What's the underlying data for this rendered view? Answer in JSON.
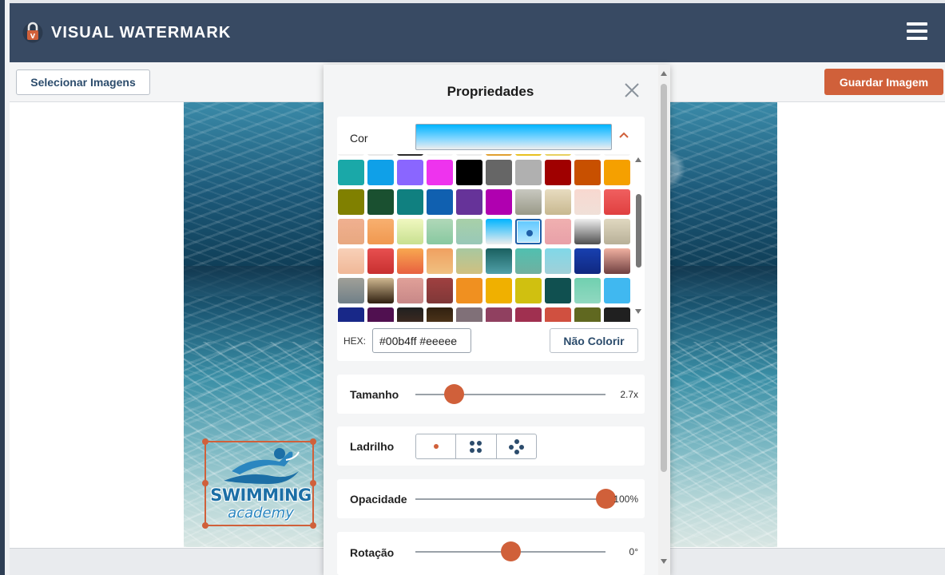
{
  "app": {
    "brand": "VISUAL WATERMARK"
  },
  "toolbar": {
    "select_label": "Selecionar Imagens",
    "save_label": "Guardar Imagem"
  },
  "watermark": {
    "line1": "SWIMMING",
    "line2": "academy"
  },
  "panel": {
    "title": "Propriedades",
    "color": {
      "label": "Cor",
      "hex_label": "HEX:",
      "hex_value": "#00b4ff #eeeee",
      "no_color_label": "Não Colorir"
    },
    "size": {
      "label": "Tamanho",
      "value_text": "2.7x",
      "fraction": 0.2
    },
    "tile": {
      "label": "Ladrilho"
    },
    "opacity": {
      "label": "Opacidade",
      "value_text": "100%",
      "fraction": 1.0
    },
    "rotation": {
      "label": "Rotação",
      "value_text": "0°",
      "fraction": 0.5
    }
  },
  "colors": {
    "accent": "#d0603a",
    "header": "#384a63"
  }
}
